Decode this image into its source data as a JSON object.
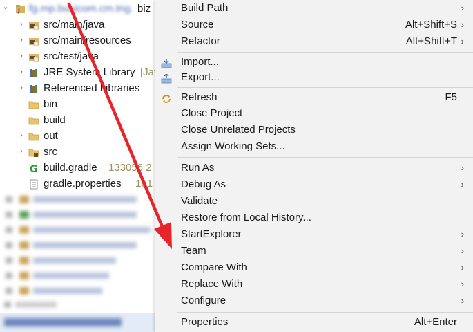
{
  "tree": {
    "project_name_blurred": "fg.mp.busicom.cm.tng.",
    "project_suffix": "biz",
    "items": [
      {
        "label": "src/main/java",
        "meta": ""
      },
      {
        "label": "src/main/resources",
        "meta": ""
      },
      {
        "label": "src/test/java",
        "meta": ""
      },
      {
        "label": "JRE System Library",
        "meta": "[Jav"
      },
      {
        "label": "Referenced Libraries",
        "meta": ""
      },
      {
        "label": "bin",
        "meta": ""
      },
      {
        "label": "build",
        "meta": ""
      },
      {
        "label": "out",
        "meta": ""
      },
      {
        "label": "src",
        "meta": ""
      },
      {
        "label": "build.gradle",
        "meta": "133056  2"
      },
      {
        "label": "gradle.properties",
        "meta": "101"
      }
    ],
    "status_blurred": "mp.busicom.cm.tng.biz"
  },
  "menu": {
    "items": [
      {
        "label": "Build Path",
        "shortcut": "",
        "submenu": true
      },
      {
        "label": "Source",
        "shortcut": "Alt+Shift+S",
        "submenu": true
      },
      {
        "label": "Refactor",
        "shortcut": "Alt+Shift+T",
        "submenu": true
      },
      {
        "label": "Import...",
        "shortcut": "",
        "submenu": false
      },
      {
        "label": "Export...",
        "shortcut": "",
        "submenu": false
      },
      {
        "label": "Refresh",
        "shortcut": "F5",
        "submenu": false
      },
      {
        "label": "Close Project",
        "shortcut": "",
        "submenu": false
      },
      {
        "label": "Close Unrelated Projects",
        "shortcut": "",
        "submenu": false
      },
      {
        "label": "Assign Working Sets...",
        "shortcut": "",
        "submenu": false
      },
      {
        "label": "Run As",
        "shortcut": "",
        "submenu": true
      },
      {
        "label": "Debug As",
        "shortcut": "",
        "submenu": true
      },
      {
        "label": "Validate",
        "shortcut": "",
        "submenu": false
      },
      {
        "label": "Restore from Local History...",
        "shortcut": "",
        "submenu": false
      },
      {
        "label": "StartExplorer",
        "shortcut": "",
        "submenu": true
      },
      {
        "label": "Team",
        "shortcut": "",
        "submenu": true
      },
      {
        "label": "Compare With",
        "shortcut": "",
        "submenu": true
      },
      {
        "label": "Replace With",
        "shortcut": "",
        "submenu": true
      },
      {
        "label": "Configure",
        "shortcut": "",
        "submenu": true
      },
      {
        "label": "Properties",
        "shortcut": "Alt+Enter",
        "submenu": false
      }
    ],
    "submenu_glyph": "›"
  },
  "glyphs": {
    "chevron_down": "⌄",
    "chevron_right": "›"
  },
  "colors": {
    "annotation_arrow": "#e8242b",
    "menu_bg": "#f2f2f2",
    "tree_meta": "#9c8f62"
  }
}
